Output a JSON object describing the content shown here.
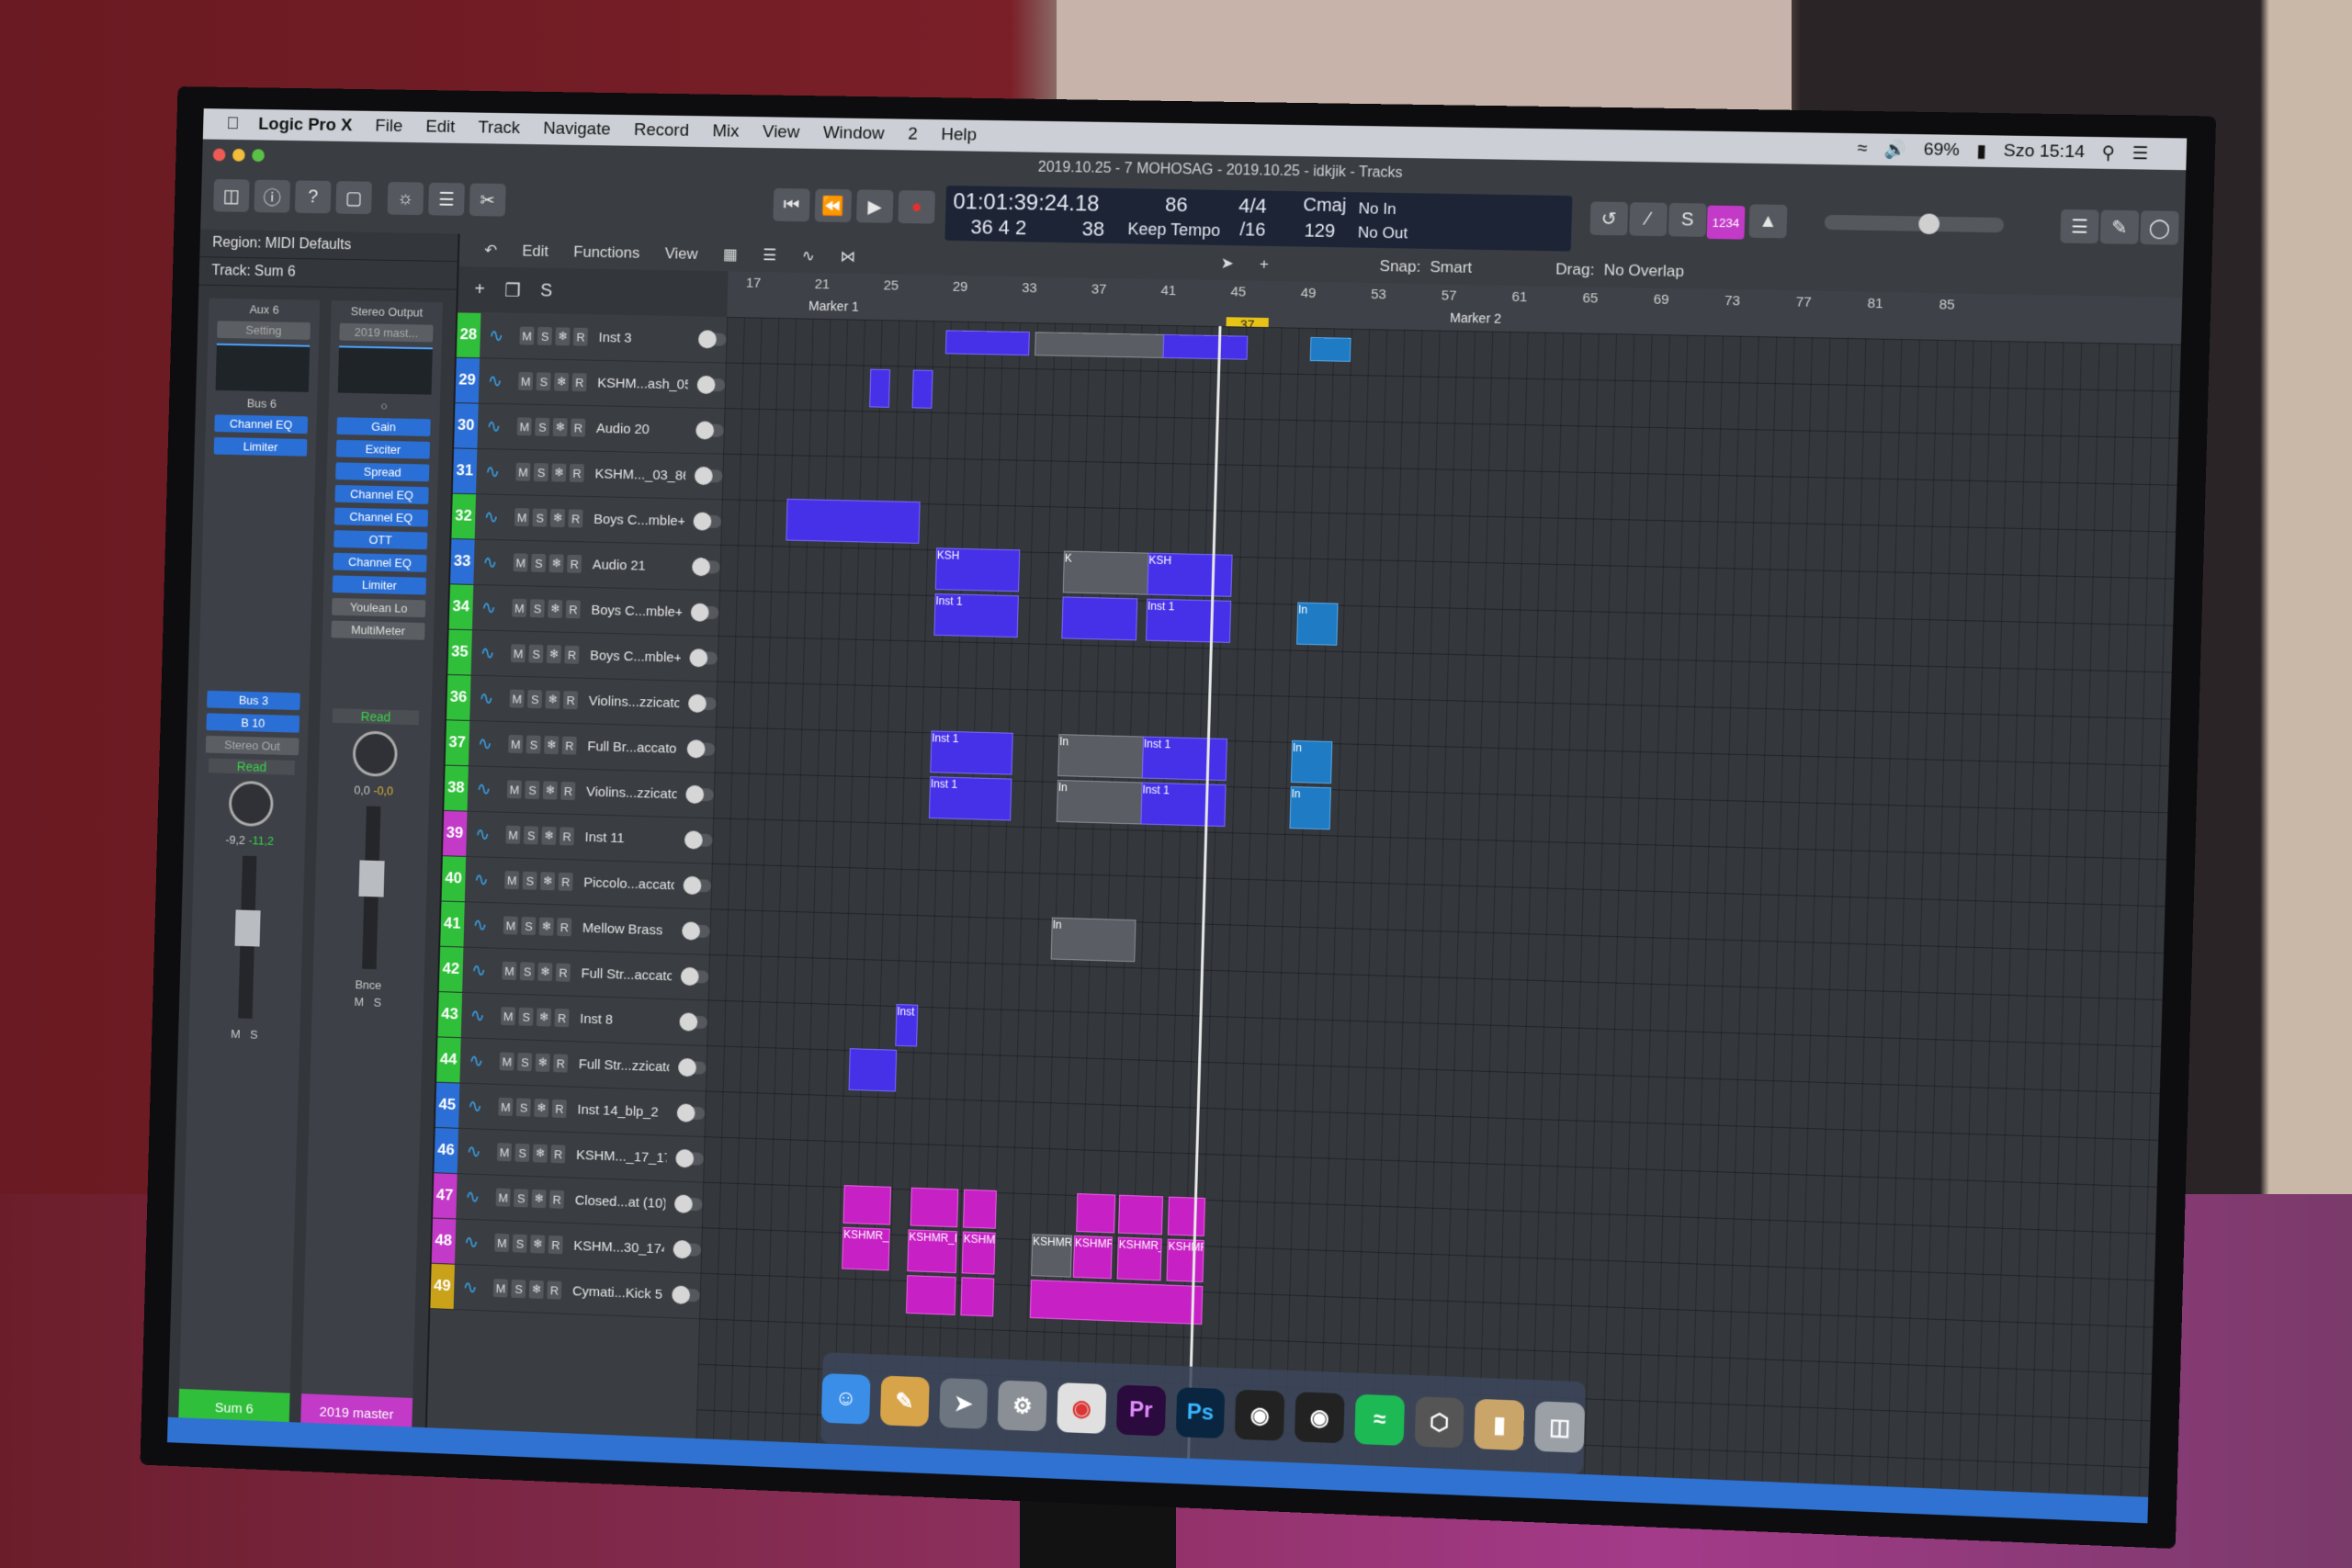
{
  "menubar": {
    "app_name": "Logic Pro X",
    "items": [
      "File",
      "Edit",
      "Track",
      "Navigate",
      "Record",
      "Mix",
      "View",
      "Window",
      "2",
      "Help"
    ],
    "battery": "69%",
    "clock": "Szo 15:14"
  },
  "window": {
    "title": "2019.10.25 - 7 MOHOSAG - 2019.10.25 - idkjik - Tracks"
  },
  "lcd": {
    "time": "01:01:39:24.18",
    "bars": "36  4  2",
    "sub": "38",
    "tempo": "86",
    "tempo_mode": "Keep Tempo",
    "sig_top": "4/4",
    "sig_bottom": "/16",
    "key": "Cmaj",
    "key_num": "129",
    "in": "No In",
    "out": "No Out"
  },
  "badge": "1234",
  "inspector": {
    "region": "Region: MIDI Defaults",
    "track": "Track: Sum 6",
    "left_strip": {
      "top": "Aux 6",
      "setting": "Setting",
      "bus": "Bus 6",
      "plugins": [
        "Channel EQ",
        "Limiter"
      ],
      "sends": [
        "Bus 3",
        "B 10"
      ],
      "output": "Stereo Out",
      "mode": "Read",
      "vol": "-9,2",
      "peak": "-11,2",
      "m": "M",
      "s": "S",
      "name": "Sum 6"
    },
    "right_strip": {
      "top": "Stereo Output",
      "setting": "2019 mast...",
      "plugins": [
        "Gain",
        "Exciter",
        "Spread",
        "Channel EQ",
        "Channel EQ",
        "OTT",
        "Channel EQ",
        "Limiter",
        "Youlean Lo",
        "MultiMeter"
      ],
      "mode": "Read",
      "vol": "0,0",
      "peak": "-0,0",
      "bnce": "Bnce",
      "m": "M",
      "s": "S",
      "name": "2019 master"
    }
  },
  "tracks_toolbar": {
    "edit": "Edit",
    "functions": "Functions",
    "view": "View",
    "snap_label": "Snap:",
    "snap_value": "Smart",
    "drag_label": "Drag:",
    "drag_value": "No Overlap"
  },
  "ruler": {
    "ticks": [
      "17",
      "21",
      "25",
      "29",
      "33",
      "37",
      "41",
      "45",
      "49",
      "53",
      "57",
      "61",
      "65",
      "69",
      "73",
      "77",
      "81",
      "85"
    ],
    "marker1": "Marker 1",
    "marker2": "Marker 2"
  },
  "tracks": [
    {
      "num": "28",
      "name": "Inst 3",
      "color": "#2fbf3a"
    },
    {
      "num": "29",
      "name": "KSHM...ash_05",
      "color": "#2b6fd6"
    },
    {
      "num": "30",
      "name": "Audio 20",
      "color": "#2b6fd6"
    },
    {
      "num": "31",
      "name": "KSHM..._03_86",
      "color": "#2b6fd6"
    },
    {
      "num": "32",
      "name": "Boys C...mble+",
      "color": "#2fbf3a"
    },
    {
      "num": "33",
      "name": "Audio 21",
      "color": "#2b6fd6"
    },
    {
      "num": "34",
      "name": "Boys C...mble+",
      "color": "#2fbf3a"
    },
    {
      "num": "35",
      "name": "Boys C...mble+",
      "color": "#2fbf3a"
    },
    {
      "num": "36",
      "name": "Violins...zzicato",
      "color": "#2fbf3a"
    },
    {
      "num": "37",
      "name": "Full Br...accato",
      "color": "#2fbf3a"
    },
    {
      "num": "38",
      "name": "Violins...zzicato",
      "color": "#2fbf3a"
    },
    {
      "num": "39",
      "name": "Inst 11",
      "color": "#c23ac7"
    },
    {
      "num": "40",
      "name": "Piccolo...accato",
      "color": "#2fbf3a"
    },
    {
      "num": "41",
      "name": "Mellow Brass",
      "color": "#2fbf3a"
    },
    {
      "num": "42",
      "name": "Full Str...accato",
      "color": "#2fbf3a"
    },
    {
      "num": "43",
      "name": "Inst 8",
      "color": "#2fbf3a"
    },
    {
      "num": "44",
      "name": "Full Str...zzicato",
      "color": "#2fbf3a"
    },
    {
      "num": "45",
      "name": "Inst 14_blp_2",
      "color": "#2b6fd6"
    },
    {
      "num": "46",
      "name": "KSHM..._17_174",
      "color": "#2b6fd6"
    },
    {
      "num": "47",
      "name": "Closed...at (10)",
      "color": "#c23ac7"
    },
    {
      "num": "48",
      "name": "KSHM...30_174",
      "color": "#c23ac7"
    },
    {
      "num": "49",
      "name": "Cymati...Kick 5",
      "color": "#c9a21a"
    }
  ],
  "regions": {
    "ksh": "KSH",
    "inst1": "Inst 1",
    "inst": "Inst",
    "in": "In",
    "kshmr_hip": "KSHMR_Hip",
    "kshmr_hi": "KSHMR_Hi",
    "kshm": "KSHM",
    "kshmr": "KSHMR",
    "k": "K"
  },
  "dock": [
    "Finder",
    "Notes",
    "Launchpad",
    "Utility",
    "Chrome",
    "Pr",
    "Ps",
    "Logic",
    "Logic",
    "Spotify",
    "App",
    "Files",
    "Trash"
  ]
}
